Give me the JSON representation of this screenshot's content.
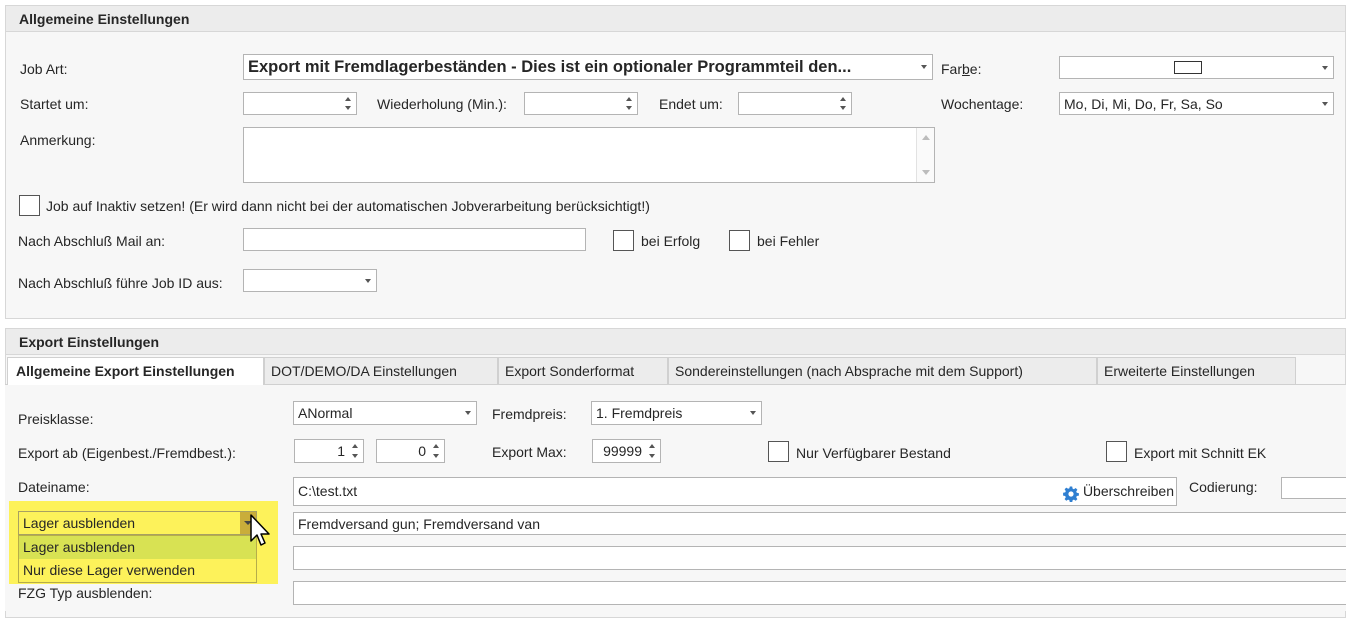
{
  "general": {
    "header": "Allgemeine Einstellungen",
    "job_art_label": "Job Art:",
    "job_art_value": "Export mit Fremdlagerbeständen - Dies ist ein optionaler Programmteil den...",
    "farbe_label_pre": "Far",
    "farbe_label_u": "b",
    "farbe_label_post": "e:",
    "startet_label": "Startet um:",
    "startet_value": "",
    "wiederholung_label": "Wiederholung (Min.):",
    "wiederholung_value": "",
    "endet_label": "Endet um:",
    "endet_value": "",
    "wochentage_label": "Wochentage:",
    "wochentage_value": "Mo, Di, Mi, Do, Fr, Sa, So",
    "anmerkung_label": "Anmerkung:",
    "anmerkung_value": "",
    "inaktiv_label": "Job auf Inaktiv setzen! (Er wird dann nicht bei der automatischen Jobverarbeitung berücksichtigt!)",
    "mail_label": "Nach Abschluß Mail an:",
    "mail_value": "",
    "bei_erfolg_label": "bei Erfolg",
    "bei_fehler_label": "bei Fehler",
    "job_id_label": "Nach Abschluß führe Job ID aus:",
    "job_id_value": ""
  },
  "export": {
    "header": "Export Einstellungen",
    "tabs": [
      {
        "label": "Allgemeine Export Einstellungen",
        "active": true
      },
      {
        "label": "DOT/DEMO/DA Einstellungen",
        "active": false
      },
      {
        "label": "Export Sonderformat",
        "active": false
      },
      {
        "label": "Sondereinstellungen (nach Absprache mit dem Support)",
        "active": false
      },
      {
        "label": "Erweiterte Einstellungen",
        "active": false
      }
    ],
    "preisklasse_label": "Preisklasse:",
    "preisklasse_value": "ANormal",
    "fremdpreis_label": "Fremdpreis:",
    "fremdpreis_value": "1. Fremdpreis",
    "export_ab_label": "Export ab (Eigenbest./Fremdbest.):",
    "export_ab_eigen": "1",
    "export_ab_fremd": "0",
    "export_max_label": "Export Max:",
    "export_max_value": "99999",
    "nur_verfuegbar_label": "Nur Verfügbarer Bestand",
    "schnitt_ek_label": "Export mit Schnitt EK",
    "dateiname_label": "Dateiname:",
    "dateiname_value": "C:\\test.txt",
    "ueberschreiben_label": "Überschreiben",
    "codierung_label": "Codierung:",
    "codierung_value": "",
    "lager_select_value": "Lager ausblenden",
    "lager_options": [
      "Lager ausblenden",
      "Nur diese Lager verwenden"
    ],
    "lager_list_value": "Fremdversand gun; Fremdversand van",
    "row3_value": "",
    "fzg_typ_label": "FZG Typ  ausblenden:",
    "fzg_typ_value": ""
  },
  "colors": {
    "highlight": "#fdf25a",
    "dropdown_selected": "#d8e253",
    "settings_icon": "#2f7fd1"
  }
}
